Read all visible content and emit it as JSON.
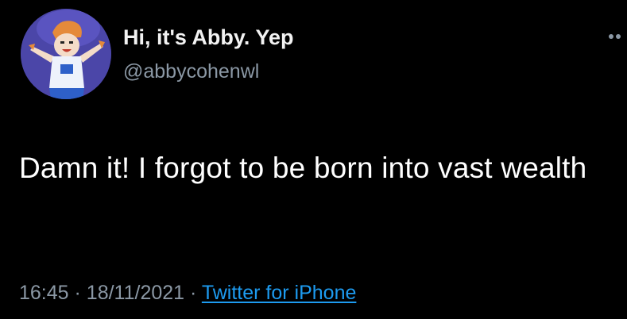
{
  "tweet": {
    "author": {
      "display_name": "Hi, it's Abby. Yep",
      "handle": "@abbycohenwl",
      "avatar_icon": "cartoon-avatar-icon"
    },
    "more_icon": "more-options-icon",
    "text": "Damn it! I forgot to be born into vast wealth",
    "time": "16:45",
    "separator": "·",
    "date": "18/11/2021",
    "source": "Twitter for iPhone"
  },
  "colors": {
    "background": "#000000",
    "text": "#ffffff",
    "secondary_text": "#8b98a5",
    "link": "#1d9bf0",
    "avatar_bg": "#4b46a8"
  }
}
